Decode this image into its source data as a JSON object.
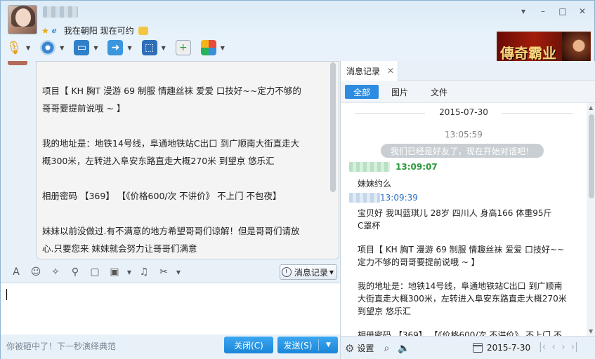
{
  "header": {
    "contact_name": "妹妹",
    "signature": "我在朝阳 现在可约",
    "window_controls": [
      "▾",
      "–",
      "□",
      "✕"
    ]
  },
  "ad": {
    "text": "傳奇霸业"
  },
  "toolbar": {
    "items": [
      {
        "name": "voice-call",
        "icon": "microphone-icon"
      },
      {
        "name": "video-call",
        "icon": "webcam-icon"
      },
      {
        "name": "share-screen",
        "icon": "screen-share-icon"
      },
      {
        "name": "send-file",
        "icon": "folder-send-icon"
      },
      {
        "name": "remote-desktop",
        "icon": "remote-desktop-icon"
      },
      {
        "name": "new-discussion",
        "icon": "chat-plus-icon"
      },
      {
        "name": "apps",
        "icon": "app-grid-icon"
      }
    ]
  },
  "chat": {
    "lines": [
      "项目【 KH  胸T 漫游 69 制服 情趣丝袜 爱爱 口技好~~定力不够的",
      "哥哥要提前说哦 ~ 】",
      "",
      "我的地址是：地铁14号线，阜通地铁站C出口 到广顺南大街直走大",
      "概300米，左转进入阜安东路直走大概270米  到望京 悠乐汇",
      "",
      "相册密码 【369】 【《价格600/次 不讲价》  不上门 不包夜】",
      "",
      "妹妹以前没做过.有不满意的地方希望哥哥们谅解！但是哥哥们请放",
      "心.只要您来 妹妹就会努力让哥哥们满意"
    ]
  },
  "format_bar": {
    "history_label": "消息记录"
  },
  "input": {
    "value": ""
  },
  "bottom": {
    "tip": "你被砸中了！下一秒演绎典范",
    "close_label": "关闭(C)",
    "send_label": "发送(S)"
  },
  "history": {
    "tab_label": "消息记录",
    "filters": [
      "全部",
      "图片",
      "文件"
    ],
    "date": "2015-07-30",
    "system_time": "13:05:59",
    "system_message": "我们已经是好友了，现在开始对话吧！",
    "msg1_time": "13:09:07",
    "msg1_text": "妹妹约么",
    "msg2_time": "13:09:39",
    "msg2_lines": [
      "宝贝好  我叫蓝琪儿 28岁 四川人  身高166 体重95斤",
      "C罩杯",
      "",
      "项目【 KH  胸T 漫游 69 制服 情趣丝袜 爱爱 口技好~~",
      "定力不够的哥哥要提前说哦 ~ 】",
      "",
      "我的地址是：地铁14号线，阜通地铁站C出口 到广顺南",
      "大街直走大概300米，左转进入阜安东路直走大概270米",
      " 到望京 悠乐汇",
      "",
      "相册密码 【369】 【《价格600/次 不讲价》  不上门 不"
    ],
    "settings_label": "设置",
    "footer_date": "2015-7-30"
  }
}
